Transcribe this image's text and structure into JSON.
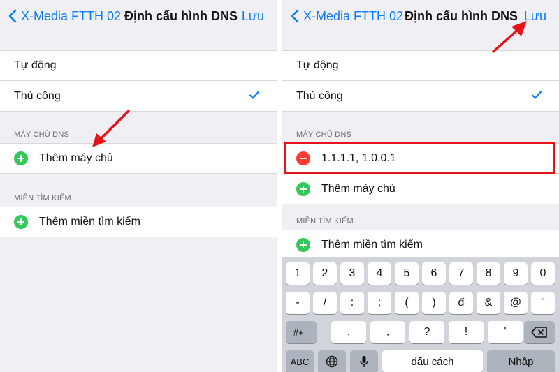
{
  "navbar": {
    "back_label": "X-Media FTTH 02",
    "title": "Định cấu hình DNS",
    "save_label": "Lưu"
  },
  "dns_mode": {
    "automatic": "Tự động",
    "manual": "Thủ công"
  },
  "dns_servers": {
    "header": "MÁY CHỦ DNS",
    "added_server": "1.1.1.1, 1.0.0.1",
    "add_server": "Thêm máy chủ"
  },
  "search_domains": {
    "header": "MIỀN TÌM KIẾM",
    "add_domain": "Thêm miền tìm kiếm"
  },
  "keyboard": {
    "row1": [
      "1",
      "2",
      "3",
      "4",
      "5",
      "6",
      "7",
      "8",
      "9",
      "0"
    ],
    "row2": [
      "-",
      "/",
      ":",
      ";",
      "(",
      ")",
      "đ",
      "&",
      "@",
      "\""
    ],
    "shift_label": "#+=",
    "row3": [
      ".",
      ",",
      "?",
      "!",
      "'"
    ],
    "abc_label": "ABC",
    "space_label": "dấu cách",
    "return_label": "Nhập"
  },
  "colors": {
    "accent": "#0a7cff",
    "add_green": "#34c759",
    "delete_red": "#ff3b30",
    "annotation_red": "#e4141a"
  }
}
